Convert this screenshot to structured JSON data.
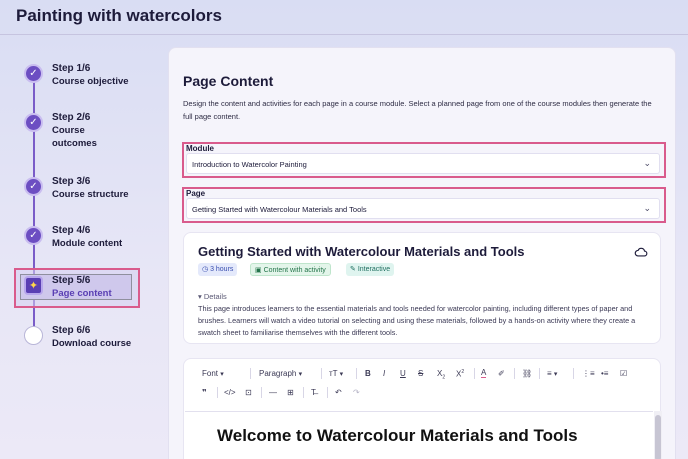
{
  "app": {
    "title": "Painting with watercolors"
  },
  "stepper": {
    "steps": [
      {
        "num": "Step 1/6",
        "label": "Course objective",
        "status": "complete",
        "icon": "check-icon"
      },
      {
        "num": "Step 2/6",
        "label": "Course outcomes",
        "status": "complete",
        "icon": "check-icon"
      },
      {
        "num": "Step 3/6",
        "label": "Course structure",
        "status": "complete",
        "icon": "check-icon"
      },
      {
        "num": "Step 4/6",
        "label": "Module content",
        "status": "complete",
        "icon": "check-icon"
      },
      {
        "num": "Step 5/6",
        "label": "Page content",
        "status": "current",
        "icon": "sparkle-icon"
      },
      {
        "num": "Step 6/6",
        "label": "Download course",
        "status": "pending",
        "icon": "empty-circle-icon"
      }
    ]
  },
  "panel": {
    "title": "Page Content",
    "description": "Design the content and activities for each page in a course module. Select a planned page from one of the course modules then generate the full page content."
  },
  "module_field": {
    "label": "Module",
    "value": "Introduction to Watercolor Painting"
  },
  "page_field": {
    "label": "Page",
    "value": "Getting Started with Watercolour Materials and Tools"
  },
  "page_card": {
    "title": "Getting Started with Watercolour Materials and Tools",
    "badges": {
      "time": "3 hours",
      "activity": "Content with activity",
      "interactive": "Interactive"
    },
    "details_label": "▾ Details",
    "details_text": "This page introduces learners to the essential materials and tools needed for watercolor painting, including different types of paper and brushes. Learners will watch a video tutorial on selecting and using these materials, followed by a hands-on activity where they create a swatch sheet to familiarise themselves with the different tools."
  },
  "editor": {
    "toolbar": {
      "font": "Font",
      "paragraph": "Paragraph",
      "text_size": "ᴛT"
    },
    "heading": "Welcome to Watercolour Materials and Tools"
  },
  "colors": {
    "accent": "#6c4ec2",
    "highlight_border": "#d95b8c"
  }
}
